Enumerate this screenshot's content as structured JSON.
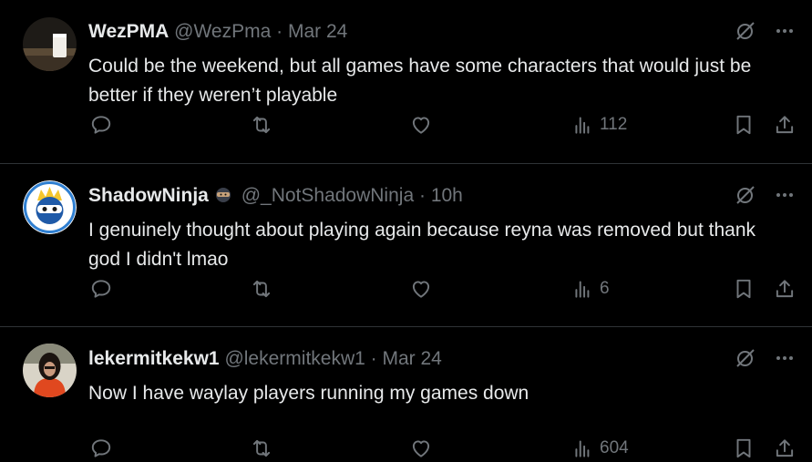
{
  "colors": {
    "background": "#000000",
    "text": "#e7e9ea",
    "muted": "#71767b",
    "divider": "#2f3336"
  },
  "tweets": [
    {
      "name": "WezPMA",
      "handle": "@WezPma",
      "separator": "·",
      "time": "Mar 24",
      "text": "Could be the weekend, but all games have some characters that would just be better if they weren’t playable",
      "views": "112",
      "avatar": "milk-glass-avatar"
    },
    {
      "name": "ShadowNinja",
      "handle": "@_NotShadowNinja",
      "separator": "·",
      "time": "10h",
      "text": "I genuinely thought about playing again because reyna was removed but thank god I didn't lmao",
      "views": "6",
      "avatar": "ninja-avatar",
      "badge": "ninja-emoji"
    },
    {
      "name": "lekermitkekw1",
      "handle": "@lekermitkekw1",
      "separator": "·",
      "time": "Mar 24",
      "text": "Now I have waylay players running my games down",
      "views": "604",
      "avatar": "person-avatar"
    }
  ]
}
